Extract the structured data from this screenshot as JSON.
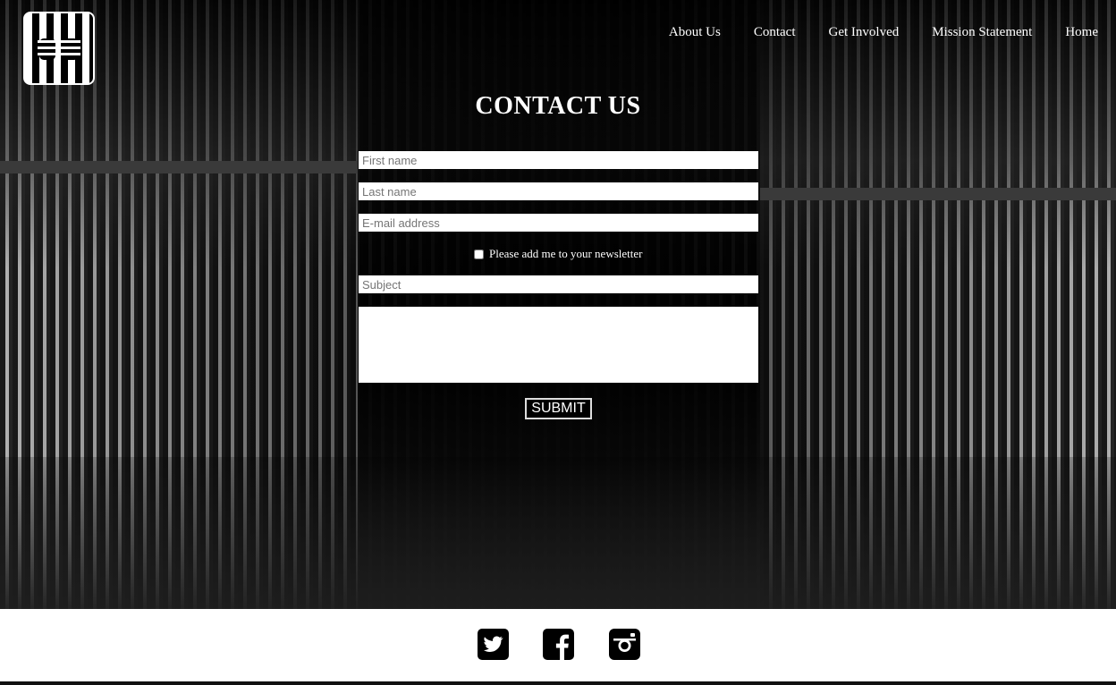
{
  "nav": {
    "items": [
      {
        "label": "About Us"
      },
      {
        "label": "Contact"
      },
      {
        "label": "Get Involved"
      },
      {
        "label": "Mission Statement"
      },
      {
        "label": "Home"
      }
    ]
  },
  "logo": {
    "icon": "hands-behind-bars-icon"
  },
  "page": {
    "title": "CONTACT US"
  },
  "form": {
    "first_name_placeholder": "First name",
    "last_name_placeholder": "Last name",
    "email_placeholder": "E-mail address",
    "newsletter_label": "Please add me to your newsletter",
    "newsletter_checked": false,
    "subject_placeholder": "Subject",
    "message_value": "",
    "submit_label": "SUBMIT"
  },
  "footer": {
    "social": [
      {
        "icon": "twitter-icon"
      },
      {
        "icon": "facebook-icon"
      },
      {
        "icon": "instagram-icon"
      }
    ]
  },
  "colors": {
    "background": "#000000",
    "text": "#ffffff",
    "footer_background": "#ffffff",
    "icon_color": "#000000"
  }
}
